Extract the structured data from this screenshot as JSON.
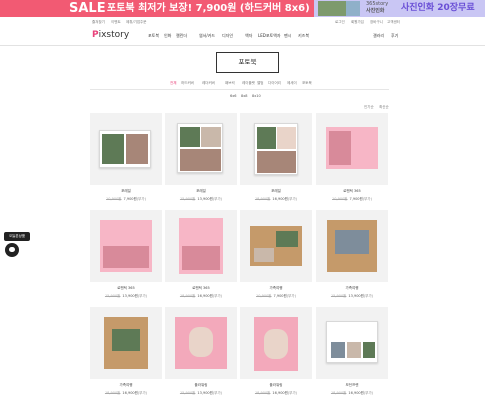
{
  "banners": {
    "sale": {
      "badge": "SALE",
      "text": "포토북 최저가 보장! 7,900원 (하드커버 8x6)",
      "bg": "#f25a73"
    },
    "photo": {
      "brand": "365story",
      "brand2": "사진인화",
      "text": "사진인화 20장무료",
      "bg": "#c9c6f4"
    }
  },
  "util": {
    "left": [
      "즐겨찾기",
      "이벤트",
      "제휴/기업주문"
    ],
    "right": [
      "로그인",
      "회원가입",
      "장바구니",
      "고객센터"
    ]
  },
  "header": {
    "logo_p": "P",
    "logo_rest": "ixstory",
    "nav": [
      "포토북",
      "인화",
      "캘린더",
      "엽서/카드",
      "디자인",
      "액자",
      "LED포토액자",
      "팬시",
      "키즈북"
    ],
    "right": [
      "갤러리",
      "후기"
    ]
  },
  "title": "포토북",
  "tabs": [
    "전체",
    "하드커버",
    "레더커버",
    "패브릭",
    "레이플랫",
    "앨범",
    "다이어리",
    "에세이",
    "포토북"
  ],
  "sizes": [
    "6x6",
    "8x8",
    "8x10"
  ],
  "sorts": [
    "인기순",
    "최신순"
  ],
  "products": [
    {
      "name": "포레일",
      "old": "10,900원",
      "price": "7,900원",
      "note": "(부가)"
    },
    {
      "name": "포레일",
      "old": "15,900원",
      "price": "13,900원",
      "note": "(부가)"
    },
    {
      "name": "포레일",
      "old": "18,900원",
      "price": "16,900원",
      "note": "(부가)"
    },
    {
      "name": "로맨틱 365",
      "old": "10,900원",
      "price": "7,900원",
      "note": "(부가)"
    },
    {
      "name": "로맨틱 365",
      "old": "15,900원",
      "price": "13,900원",
      "note": "(부가)"
    },
    {
      "name": "로맨틱 365",
      "old": "18,900원",
      "price": "16,900원",
      "note": "(부가)"
    },
    {
      "name": "가족여행",
      "old": "10,900원",
      "price": "7,900원",
      "note": "(부가)"
    },
    {
      "name": "가족여행",
      "old": "15,900원",
      "price": "13,900원",
      "note": "(부가)"
    },
    {
      "name": "가족여행",
      "old": "18,900원",
      "price": "16,900원",
      "note": "(부가)"
    },
    {
      "name": "플라워링",
      "old": "15,900원",
      "price": "13,900원",
      "note": "(부가)"
    },
    {
      "name": "플라워링",
      "old": "18,900원",
      "price": "16,900원",
      "note": "(부가)"
    },
    {
      "name": "모던프렌",
      "old": "18,900원",
      "price": "16,900원",
      "note": "(부가)"
    }
  ],
  "float": {
    "label": "오늘본상품"
  },
  "colors": {
    "accent": "#e8417a",
    "sale_banner": "#f25a73",
    "photo_banner": "#c9c6f4"
  }
}
